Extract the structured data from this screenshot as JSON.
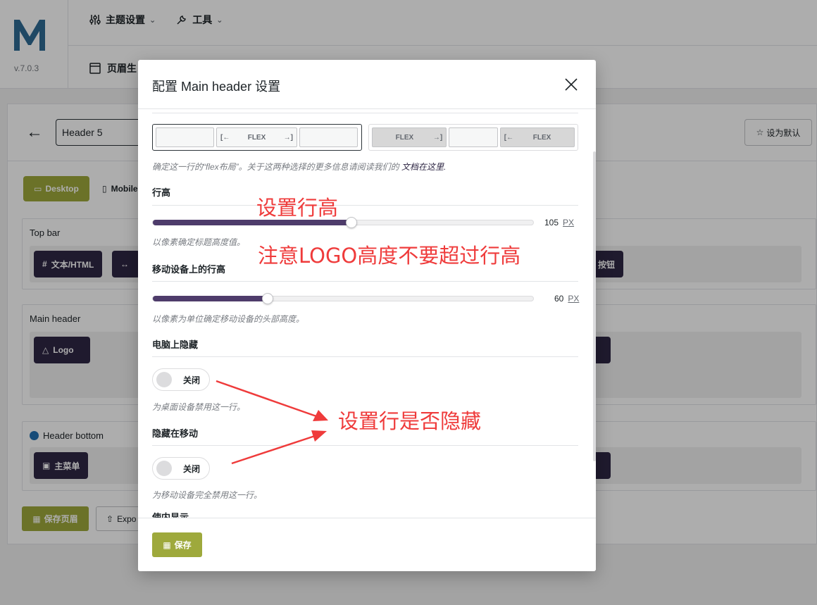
{
  "app": {
    "version": "v.7.0.3",
    "nav": [
      {
        "label": "主题设置",
        "icon": "sliders-icon"
      },
      {
        "label": "工具",
        "icon": "wrench-icon"
      }
    ],
    "subnav_label": "页眉生"
  },
  "editor": {
    "header_name": "Header 5",
    "default_btn": "设为默认",
    "tabs": {
      "desktop": "Desktop",
      "mobile": "Mobile"
    },
    "rows": {
      "top_bar": {
        "title": "Top bar",
        "chip_text_html": "文本/HTML",
        "chip_right": "按钮"
      },
      "main_header": {
        "title": "Main header",
        "chip_logo": "Logo"
      },
      "header_bottom": {
        "title": "Header bottom",
        "chip_menu": "主菜单"
      }
    },
    "save_page": "保存页眉",
    "export": "Expo"
  },
  "modal": {
    "title": "配置 Main header 设置",
    "flex_label": "FLEX",
    "flex_help_prefix": "确定这一行的“flex布局”。关于这两种选择的更多信息请阅读我们的",
    "flex_help_link": "文档在这里.",
    "row_height": {
      "label": "行高",
      "value": "105",
      "unit": "PX",
      "fraction": 0.52,
      "help": "以像素确定标题高度值。"
    },
    "mobile_row_height": {
      "label": "移动设备上的行高",
      "value": "60",
      "unit": "PX",
      "fraction": 0.3,
      "help": "以像素为单位确定移动设备的头部高度。"
    },
    "hide_desktop": {
      "label": "电脑上隐藏",
      "toggle": "关闭",
      "help": "为桌面设备禁用这一行。"
    },
    "hide_mobile": {
      "label": "隐藏在移动",
      "toggle": "关闭",
      "help": "为移动设备完全禁用这一行。"
    },
    "next_label_cut": "使内显示",
    "save": "保存"
  },
  "annotations": {
    "row_height_note": "设置行高",
    "logo_note": "注意LOGO高度不要超过行高",
    "hide_note": "设置行是否隐藏",
    "color": "#ef3b3b"
  },
  "colors": {
    "accent_green": "#9ea93c",
    "chip_dark": "#2f2745",
    "slider_fill": "#4e3c6b",
    "logo_blue": "#2f6b94"
  }
}
